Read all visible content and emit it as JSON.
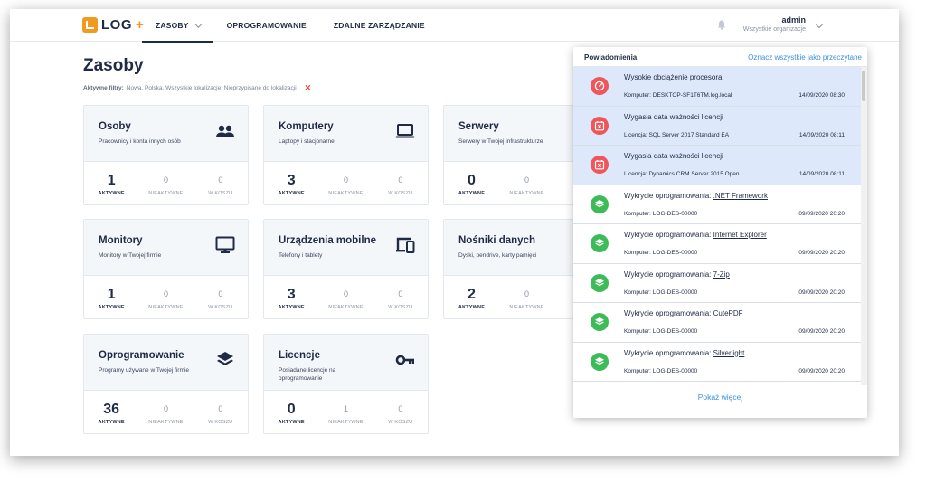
{
  "app": {
    "logo_text": "LOG",
    "logo_plus": "+"
  },
  "nav": {
    "items": [
      {
        "label": "ZASOBY"
      },
      {
        "label": "OPROGRAMOWANIE"
      },
      {
        "label": "ZDALNE ZARZĄDZANIE"
      }
    ]
  },
  "user": {
    "name": "admin",
    "org": "Wszystkie organizacje"
  },
  "page": {
    "title": "Zasoby",
    "filters_label": "Aktywne filtry:",
    "filters_value": "Nowa, Polska, Wszystkie lokalizacje, Nieprzypisane do lokalizacji",
    "filters_clear": "✕"
  },
  "stat_labels": {
    "active": "AKTYWNE",
    "inactive": "NIEAKTYWNE",
    "trash": "W KOSZU"
  },
  "cards": [
    {
      "title": "Osoby",
      "subtitle": "Pracownicy i konta innych osób",
      "icon": "people-icon",
      "active": "1",
      "inactive": "0",
      "trash": "0"
    },
    {
      "title": "Komputery",
      "subtitle": "Laptopy i stacjonarne",
      "icon": "laptop-icon",
      "active": "3",
      "inactive": "0",
      "trash": "0"
    },
    {
      "title": "Serwery",
      "subtitle": "Serwery w Twojej infrastrukturze",
      "icon": "server-icon",
      "active": "0",
      "inactive": "0",
      "trash": ""
    },
    {
      "title": "Monitory",
      "subtitle": "Monitory w Twojej firmie",
      "icon": "monitor-icon",
      "active": "1",
      "inactive": "0",
      "trash": "0"
    },
    {
      "title": "Urządzenia mobilne",
      "subtitle": "Telefony i tablety",
      "icon": "mobile-devices-icon",
      "active": "3",
      "inactive": "0",
      "trash": "0"
    },
    {
      "title": "Nośniki danych",
      "subtitle": "Dyski, pendrive, karty pamięci",
      "icon": "storage-icon",
      "active": "2",
      "inactive": "0",
      "trash": ""
    },
    {
      "title": "Oprogramowanie",
      "subtitle": "Programy używane w Twojej firmie",
      "icon": "layers-icon",
      "active": "36",
      "inactive": "0",
      "trash": "0"
    },
    {
      "title": "Licencje",
      "subtitle": "Posiadane licencje na oprogramowanie",
      "icon": "key-icon",
      "active": "0",
      "inactive": "1",
      "trash": "0"
    }
  ],
  "notifications": {
    "title": "Powiadomienia",
    "mark_all": "Oznacz wszystkie jako przeczytane",
    "show_more": "Pokaż więcej",
    "items": [
      {
        "type": "red",
        "icon": "gauge-icon",
        "unread": true,
        "title": "Wysokie obciążenie procesora",
        "link": "",
        "detail": "Komputer: DESKTOP-SF1T6TM.log.local",
        "date": "14/09/2020 08:30"
      },
      {
        "type": "red",
        "icon": "calendar-x-icon",
        "unread": true,
        "title": "Wygasła data ważności licencji",
        "link": "",
        "detail": "Licencja: SQL Server 2017 Standard EA",
        "date": "14/09/2020 08:11"
      },
      {
        "type": "red",
        "icon": "calendar-x-icon",
        "unread": true,
        "title": "Wygasła data ważności licencji",
        "link": "",
        "detail": "Licencja: Dynamics CRM Server 2015 Open",
        "date": "14/09/2020 08:11"
      },
      {
        "type": "green",
        "icon": "layers-icon",
        "unread": false,
        "title": "Wykrycie oprogramowania: ",
        "link": ".NET Framework",
        "detail": "Komputer: LOG-DES-00000",
        "date": "09/09/2020 20:20"
      },
      {
        "type": "green",
        "icon": "layers-icon",
        "unread": false,
        "title": "Wykrycie oprogramowania: ",
        "link": "Internet Explorer",
        "detail": "Komputer: LOG-DES-00000",
        "date": "09/09/2020 20:20"
      },
      {
        "type": "green",
        "icon": "layers-icon",
        "unread": false,
        "title": "Wykrycie oprogramowania: ",
        "link": "7-Zip",
        "detail": "Komputer: LOG-DES-00000",
        "date": "09/09/2020 20:20"
      },
      {
        "type": "green",
        "icon": "layers-icon",
        "unread": false,
        "title": "Wykrycie oprogramowania: ",
        "link": "CutePDF",
        "detail": "Komputer: LOG-DES-00000",
        "date": "09/09/2020 20:20"
      },
      {
        "type": "green",
        "icon": "layers-icon",
        "unread": false,
        "title": "Wykrycie oprogramowania: ",
        "link": "Silverlight",
        "detail": "Komputer: LOG-DES-00000",
        "date": "09/09/2020 20:20"
      }
    ]
  },
  "colors": {
    "brand": "#f29a1f",
    "navy": "#1f2a44",
    "link": "#3d8fe0",
    "alert": "#f0555a",
    "success": "#3dbb58",
    "unread_bg": "#dde8fb"
  }
}
